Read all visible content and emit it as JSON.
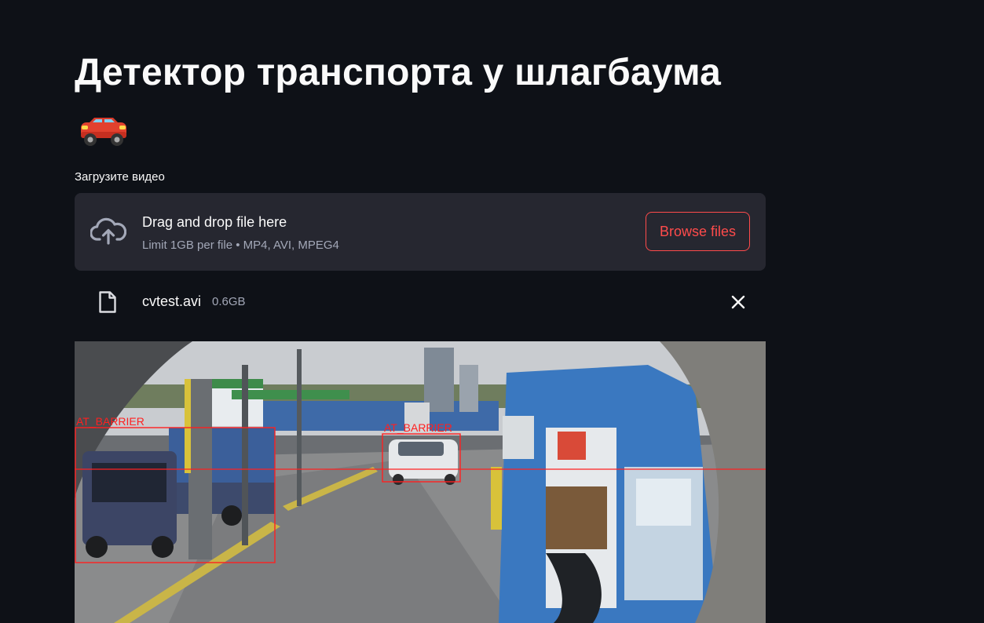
{
  "page": {
    "title": "Детектор транспорта у шлагбаума",
    "emoji": "car-emoji"
  },
  "uploader": {
    "label": "Загрузите видео",
    "drop_title": "Drag and drop file here",
    "drop_subtitle": "Limit 1GB per file • MP4, AVI, MPEG4",
    "browse_label": "Browse files"
  },
  "file": {
    "name": "cvtest.avi",
    "size": "0.6GB"
  },
  "video_frame": {
    "detections": [
      {
        "label": "AT_BARRIER",
        "object": "truck"
      },
      {
        "label": "AT_BARRIER",
        "object": "car"
      }
    ]
  },
  "colors": {
    "background": "#0e1117",
    "panel": "#262730",
    "accent": "#ff4b4b",
    "muted_text": "#a3a8b8",
    "detection": "#ff2020"
  }
}
